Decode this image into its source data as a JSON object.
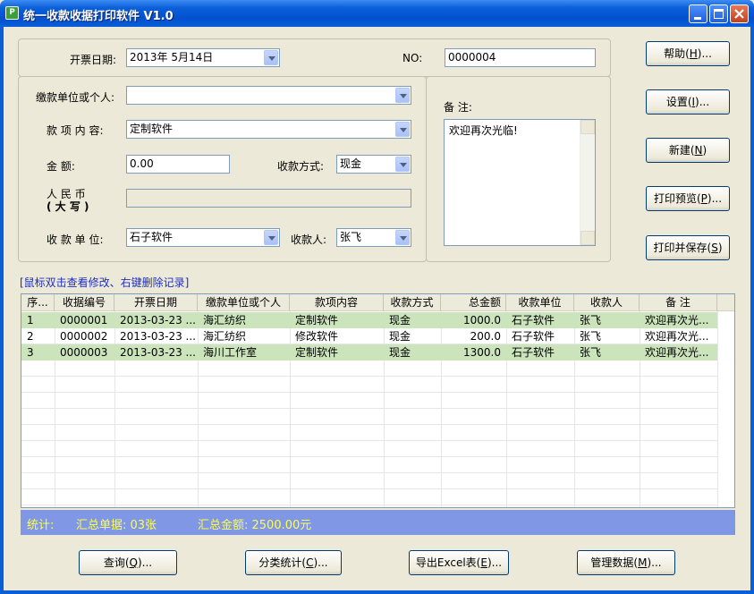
{
  "window": {
    "title": "统一收款收据打印软件 V1.0",
    "app_icon_letter": "P"
  },
  "form": {
    "date_label": "开票日期:",
    "date_value": "2013年  5月14日",
    "no_label": "NO:",
    "no_value": "0000004",
    "payer_label": "缴款单位或个人:",
    "payer_value": "",
    "item_label": "款 项 内 容:",
    "item_value": "定制软件",
    "amount_label": "金      额:",
    "amount_value": "0.00",
    "method_label": "收款方式:",
    "method_value": "现金",
    "rmb_label_line1": "人   民   币",
    "rmb_label_line2": "(  大  写  )",
    "rmb_value": "",
    "payee_unit_label": "收 款 单 位:",
    "payee_unit_value": "石子软件",
    "payee_label": "收款人:",
    "payee_value": "张飞",
    "memo_label": "备 注:",
    "memo_value": "欢迎再次光临!"
  },
  "side_buttons": [
    {
      "text": "帮助(",
      "key": "H",
      "suffix": ")..."
    },
    {
      "text": "设置(",
      "key": "I",
      "suffix": ")..."
    },
    {
      "text": "新建(",
      "key": "N",
      "suffix": ")"
    },
    {
      "text": "打印预览(",
      "key": "P",
      "suffix": ")..."
    },
    {
      "text": "打印并保存(",
      "key": "S",
      "suffix": ")"
    }
  ],
  "hint": "[鼠标双击查看修改、右键删除记录]",
  "table": {
    "columns": [
      "序...",
      "收据编号",
      "开票日期",
      "缴款单位或个人",
      "款项内容",
      "收款方式",
      "总金额",
      "收款单位",
      "收款人",
      "备 注"
    ],
    "rows": [
      [
        "1",
        "0000001",
        "2013-03-23 ...",
        "海汇纺织",
        "定制软件",
        "现金",
        "1000.0",
        "石子软件",
        "张飞",
        "欢迎再次光..."
      ],
      [
        "2",
        "0000002",
        "2013-03-23 ...",
        "海汇纺织",
        "修改软件",
        "现金",
        "200.0",
        "石子软件",
        "张飞",
        "欢迎再次光..."
      ],
      [
        "3",
        "0000003",
        "2013-03-23 ...",
        "海川工作室",
        "定制软件",
        "现金",
        "1300.0",
        "石子软件",
        "张飞",
        "欢迎再次光..."
      ]
    ]
  },
  "status": {
    "label": "统计:",
    "count": "汇总单据: 03张",
    "total": "汇总金额: 2500.00元"
  },
  "bottom_buttons": [
    {
      "text": "查询(",
      "key": "Q",
      "suffix": ")..."
    },
    {
      "text": "分类统计(",
      "key": "C",
      "suffix": ")..."
    },
    {
      "text": "导出Excel表(",
      "key": "E",
      "suffix": ")..."
    },
    {
      "text": "管理数据(",
      "key": "M",
      "suffix": ")..."
    }
  ],
  "colors": {
    "title_blue": "#0a5fd8",
    "row_green": "#cbe4bc",
    "status_bg": "#7f97e4",
    "status_text": "#ffff4a",
    "hint_blue": "#1f2fbf"
  }
}
